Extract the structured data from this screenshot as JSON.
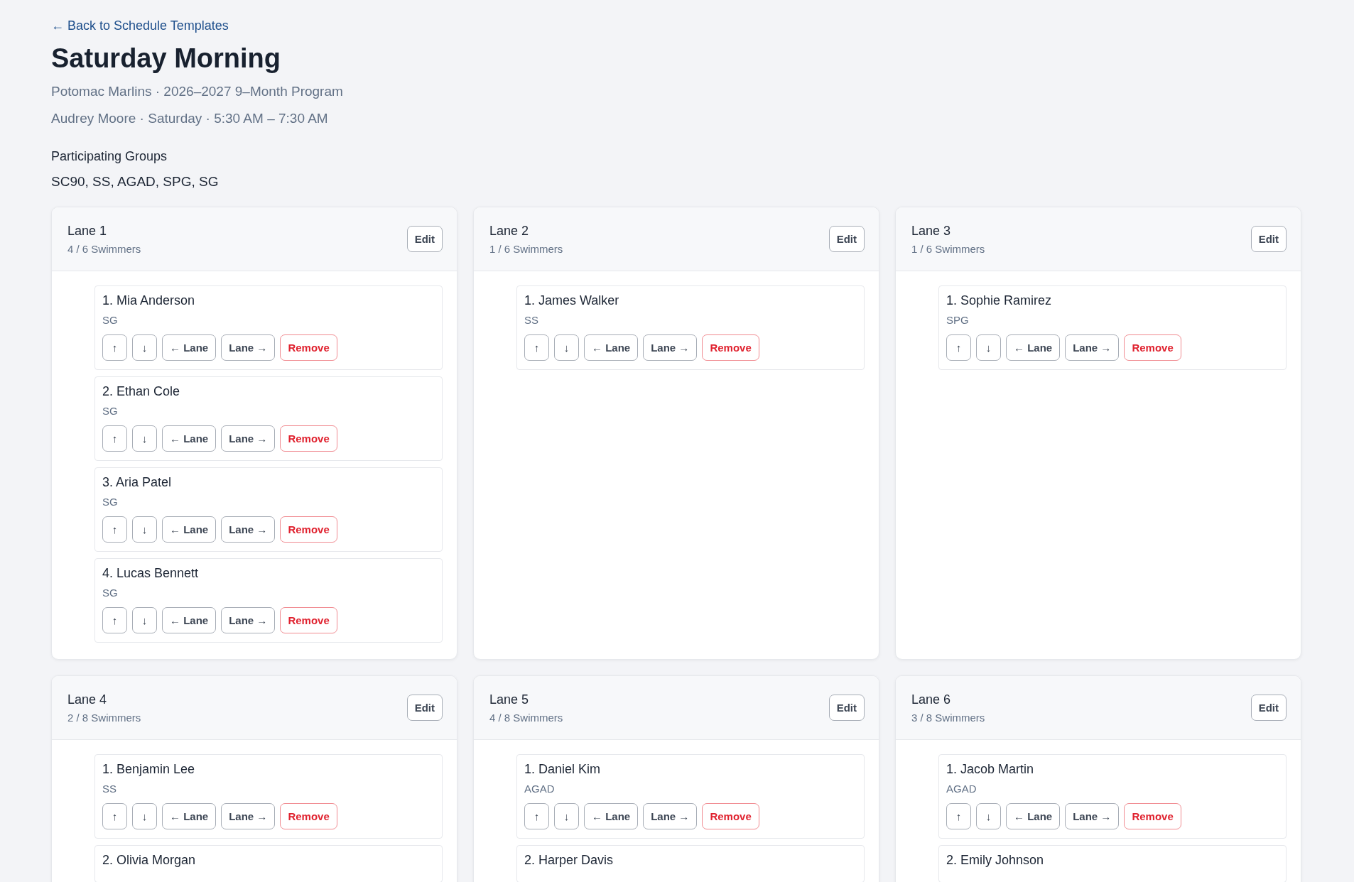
{
  "back_link": {
    "label": "← Back to Schedule Templates"
  },
  "title": "Saturday Morning",
  "subtitle_lines": [
    "Potomac Marlins · 2026–2027 9–Month Program",
    "Audrey Moore · Saturday · 5:30 AM – 7:30 AM"
  ],
  "participating_groups": {
    "heading": "Participating Groups",
    "value": "SC90, SS, AGAD, SPG, SG"
  },
  "lanes": [
    {
      "name": "Lane 1",
      "count": "4 / 6 Swimmers",
      "edit_label": "Edit",
      "swimmers": [
        {
          "name": "1. Mia Anderson",
          "group": "SG",
          "actions": [
            "↑",
            "↓",
            "← Lane",
            "Lane →",
            "Remove"
          ]
        },
        {
          "name": "2. Ethan Cole",
          "group": "SG",
          "actions": [
            "↑",
            "↓",
            "← Lane",
            "Lane →",
            "Remove"
          ]
        },
        {
          "name": "3. Aria Patel",
          "group": "SG",
          "actions": [
            "↑",
            "↓",
            "← Lane",
            "Lane →",
            "Remove"
          ]
        },
        {
          "name": "4. Lucas Bennett",
          "group": "SG",
          "actions": [
            "↑",
            "↓",
            "← Lane",
            "Lane →",
            "Remove"
          ]
        }
      ]
    },
    {
      "name": "Lane 2",
      "count": "1 / 6 Swimmers",
      "edit_label": "Edit",
      "swimmers": [
        {
          "name": "1. James Walker",
          "group": "SS",
          "actions": [
            "↑",
            "↓",
            "← Lane",
            "Lane →",
            "Remove"
          ]
        }
      ]
    },
    {
      "name": "Lane 3",
      "count": "1 / 6 Swimmers",
      "edit_label": "Edit",
      "swimmers": [
        {
          "name": "1. Sophie Ramirez",
          "group": "SPG",
          "actions": [
            "↑",
            "↓",
            "← Lane",
            "Lane →",
            "Remove"
          ]
        }
      ]
    },
    {
      "name": "Lane 4",
      "count": "2 / 8 Swimmers",
      "edit_label": "Edit",
      "swimmers": [
        {
          "name": "1. Benjamin Lee",
          "group": "SS",
          "actions": [
            "↑",
            "↓",
            "← Lane",
            "Lane →",
            "Remove"
          ]
        },
        {
          "name": "2. Olivia Morgan"
        }
      ]
    },
    {
      "name": "Lane 5",
      "count": "4 / 8 Swimmers",
      "edit_label": "Edit",
      "swimmers": [
        {
          "name": "1. Daniel Kim",
          "group": "AGAD",
          "actions": [
            "↑",
            "↓",
            "← Lane",
            "Lane →",
            "Remove"
          ]
        },
        {
          "name": "2. Harper Davis"
        }
      ]
    },
    {
      "name": "Lane 6",
      "count": "3 / 8 Swimmers",
      "edit_label": "Edit",
      "swimmers": [
        {
          "name": "1. Jacob Martin",
          "group": "AGAD",
          "actions": [
            "↑",
            "↓",
            "← Lane",
            "Lane →",
            "Remove"
          ]
        },
        {
          "name": "2. Emily Johnson"
        }
      ]
    }
  ]
}
